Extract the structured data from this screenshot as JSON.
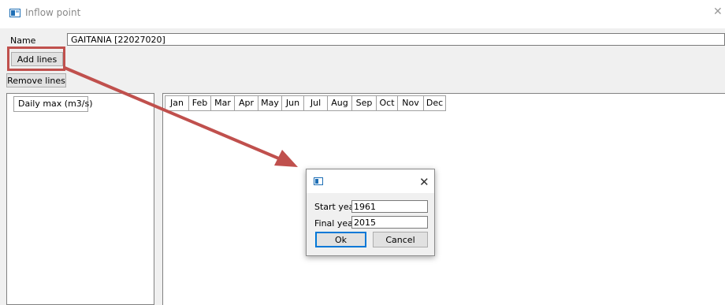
{
  "window": {
    "title": "Inflow point",
    "close_glyph": "✕",
    "icon": "app-window-icon"
  },
  "form": {
    "name_label": "Name",
    "name_value": "GAITANIA [22027020]",
    "add_lines_label": "Add lines",
    "remove_lines_label": "Remove lines"
  },
  "left_table": {
    "header": "Daily max (m3/s)"
  },
  "month_table": {
    "headers": [
      "Jan",
      "Feb",
      "Mar",
      "Apr",
      "May",
      "Jun",
      "Jul",
      "Aug",
      "Sep",
      "Oct",
      "Nov",
      "Dec"
    ]
  },
  "dialog": {
    "icon": "app-window-icon",
    "close_glyph": "✕",
    "start_year_label": "Start year",
    "start_year_value": "1961",
    "final_year_label": "Final year",
    "final_year_value": "2015",
    "ok_label": "Ok",
    "cancel_label": "Cancel"
  },
  "annotation": {
    "color": "#c0504d"
  }
}
